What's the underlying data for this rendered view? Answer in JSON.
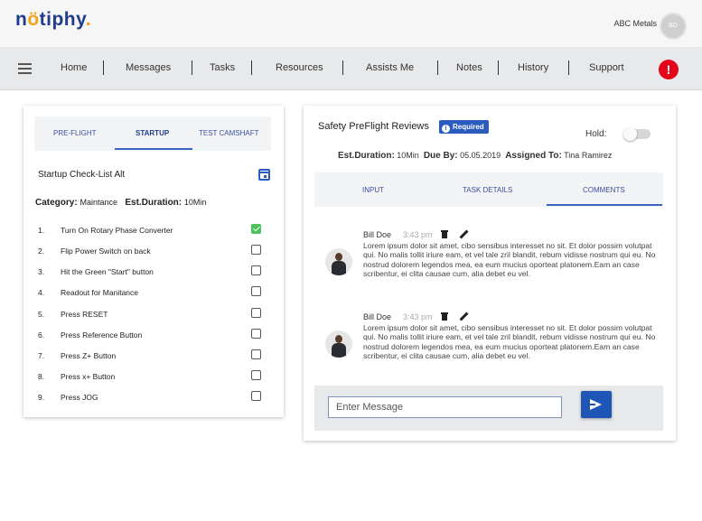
{
  "app": {
    "brand_prefix": "n",
    "brand_dot": "ö",
    "brand_suffix": "tiphy",
    "brand_period": ".",
    "company": "ABC Metals",
    "avatar_initials": "BD"
  },
  "nav": {
    "items": [
      {
        "label": "Home"
      },
      {
        "label": "Messages"
      },
      {
        "label": "Tasks"
      },
      {
        "label": "Resources"
      },
      {
        "label": "Assists Me"
      },
      {
        "label": "Notes"
      },
      {
        "label": "History"
      },
      {
        "label": "Support"
      }
    ],
    "alert_symbol": "!",
    "alert_color": "#e3061a"
  },
  "checklist": {
    "tabs": [
      {
        "label": "PRE-FLIGHT"
      },
      {
        "label": "STARTUP",
        "active": true
      },
      {
        "label": "TEST CAMSHAFT"
      }
    ],
    "title": "Startup Check-List Alt",
    "category_label": "Category:",
    "category_value": "Maintance",
    "duration_label": "Est.Duration:",
    "duration_value": "10Min",
    "items": [
      {
        "num": "1.",
        "label": "Turn On Rotary Phase Converter",
        "checked": true
      },
      {
        "num": "2.",
        "label": "Flip Power Switch on back",
        "checked": false
      },
      {
        "num": "3.",
        "label": "Hit the Green \"Start\" button",
        "checked": false
      },
      {
        "num": "4.",
        "label": "Readout for Manitance",
        "checked": false
      },
      {
        "num": "5.",
        "label": "Press RESET",
        "checked": false
      },
      {
        "num": "6.",
        "label": "Press Reference Button",
        "checked": false
      },
      {
        "num": "7.",
        "label": "Press Z+ Button",
        "checked": false
      },
      {
        "num": "8.",
        "label": "Press x+ Button",
        "checked": false
      },
      {
        "num": "9.",
        "label": "Press JOG",
        "checked": false
      }
    ]
  },
  "review": {
    "title": "Safety PreFlight Reviews",
    "badge": "Required",
    "hold_label": "Hold:",
    "hold_on": false,
    "duration_label": "Est.Duration:",
    "duration_value": "10Min",
    "due_label": "Due By:",
    "due_value": "05.05.2019",
    "assigned_label": "Assigned To:",
    "assigned_value": "Tina Ramirez",
    "tabs": [
      {
        "label": "INPUT"
      },
      {
        "label": "TASK DETAILS"
      },
      {
        "label": "COMMENTS",
        "active": true
      }
    ],
    "comments": [
      {
        "author": "Bill Doe",
        "time": "3:43 pm",
        "text": "Lorem ipsum dolor sit amet, cibo sensibus interesset no sit. Et dolor possim volutpat qui. No malis tollit iriure eam, et vel tale zril blandit, rebum vidisse nostrum qui eu. No nostrud dolorem legendos mea, ea eum mucius oporteat platonem.Eam an case scribentur, ei clita causae cum, alia debet eu vel."
      },
      {
        "author": "Bill Doe",
        "time": "3:43 pm",
        "text": "Lorem ipsum dolor sit amet, cibo sensibus interesset no sit. Et dolor possim volutpat qui. No malis tollit iriure eam, et vel tale zril blandit, rebum vidisse nostrum qui eu. No nostrud dolorem legendos mea, ea eum mucius oporteat platonem.Eam an case scribentur, ei clita causae cum, alia debet eu vel."
      }
    ],
    "message_placeholder": "Enter Message"
  },
  "colors": {
    "brand": "#1f3d8a",
    "accent": "#2a5cc0",
    "check": "#4cc25a",
    "alert": "#e3061a"
  }
}
